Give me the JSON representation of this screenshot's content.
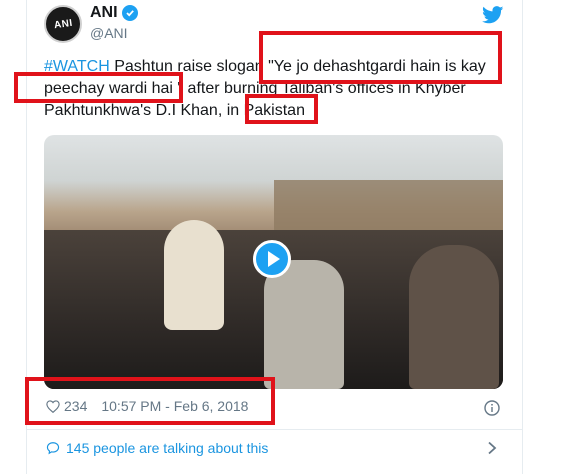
{
  "user": {
    "name": "ANI",
    "handle": "@ANI",
    "avatar_text": "ANI"
  },
  "tweet": {
    "hashtag": "#WATCH",
    "line1_rest": " Pashtun raise slogan ",
    "quote_part1": "\"Ye jo dehashtgardi hain is kay",
    "quote_part2": "peechay wardi hai \"",
    "line2_rest": " after burning Taliban's offices in Khyber",
    "line3_start": "Pakhtunkhwa's  D.I Khan, in ",
    "place": "Pakistan"
  },
  "meta": {
    "likes": "234",
    "timestamp": "10:57 PM - Feb 6, 2018"
  },
  "footer": {
    "talking": "145 people are talking about this"
  },
  "colors": {
    "twitter_blue": "#1da1f2",
    "link_blue": "#1b95e0",
    "highlight_red": "#e0121a"
  },
  "icons": [
    "verified-badge-icon",
    "twitter-bird-icon",
    "play-icon",
    "heart-icon",
    "info-icon",
    "comment-bubble-icon",
    "chevron-right-icon"
  ]
}
